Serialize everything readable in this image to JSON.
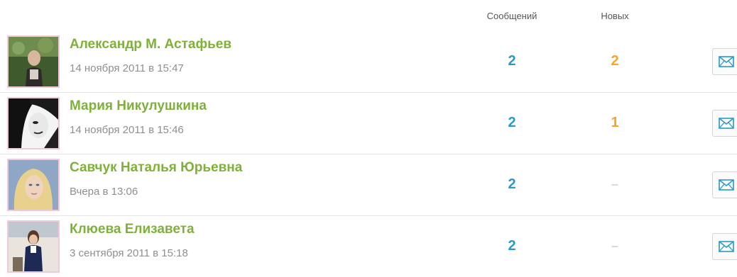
{
  "header": {
    "messages_label": "Сообщений",
    "new_label": "Новых"
  },
  "colors": {
    "name": "#7fb13a",
    "messages_count": "#2a99c8",
    "new_count": "#f5a52a",
    "date": "#8f8f8f",
    "avatar_border": "#f2c9d9",
    "envelope": "#2a99c8"
  },
  "rows": [
    {
      "name": "Александр М. Астафьев",
      "date": "14 ноября 2011 в 15:47",
      "messages": "2",
      "new": "2",
      "icon": "envelope-icon"
    },
    {
      "name": "Мария Никулушкина",
      "date": "14 ноября 2011 в 15:46",
      "messages": "2",
      "new": "1",
      "icon": "envelope-icon"
    },
    {
      "name": "Савчук Наталья Юрьевна",
      "date": "Вчера в 13:06",
      "messages": "2",
      "new": "–",
      "icon": "envelope-icon"
    },
    {
      "name": "Клюева Елизавета",
      "date": "3 сентября 2011 в 15:18",
      "messages": "2",
      "new": "–",
      "icon": "envelope-icon"
    }
  ]
}
